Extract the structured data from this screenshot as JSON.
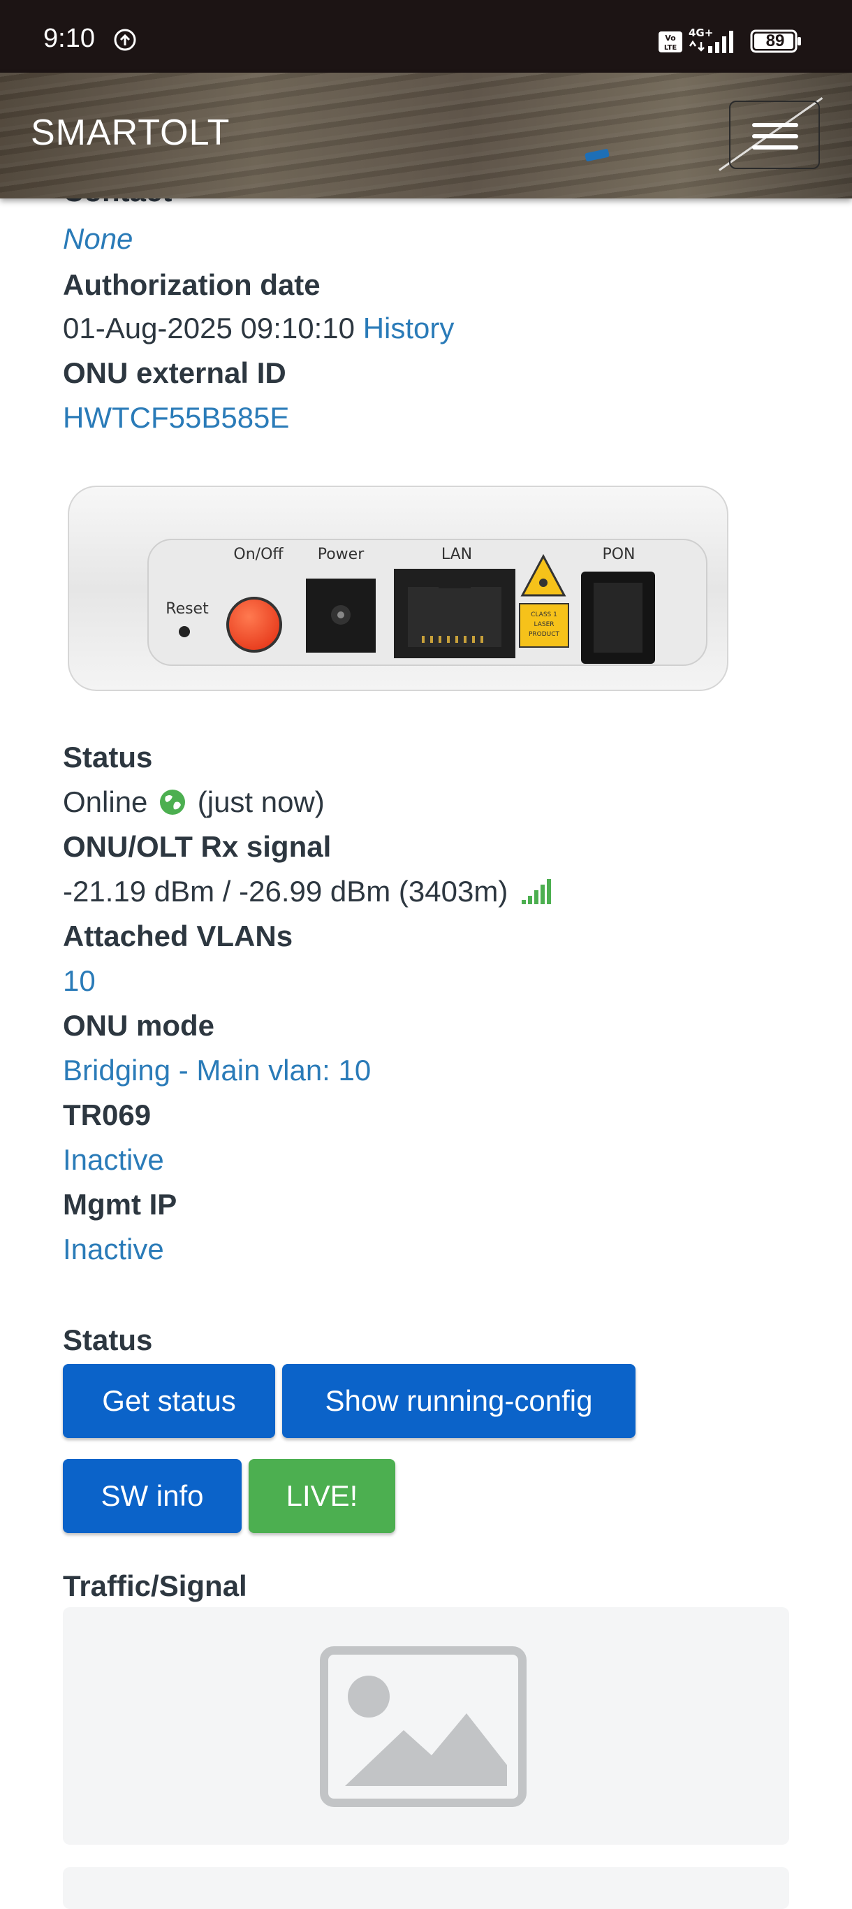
{
  "status_bar": {
    "time": "9:10",
    "net_icon": "data-saver-icon",
    "volte": "Vo LTE",
    "network": "4G+",
    "battery": "89"
  },
  "navbar": {
    "brand": "SMARTOLT",
    "menu_icon": "hamburger-menu-icon"
  },
  "details": {
    "contact_label": "Contact",
    "contact_value": "None",
    "auth_date_label": "Authorization date",
    "auth_date_value": "01-Aug-2025 09:10:10",
    "history_link": "History",
    "external_id_label": "ONU external ID",
    "external_id_value": "HWTCF55B585E",
    "device": {
      "reset": "Reset",
      "on_off": "On/Off",
      "power": "Power",
      "lan": "LAN",
      "pon": "PON",
      "laser_line1": "CLASS 1",
      "laser_line2": "LASER",
      "laser_line3": "PRODUCT"
    },
    "status_label": "Status",
    "status_value": "Online",
    "status_time": "(just now)",
    "rx_signal_label": "ONU/OLT Rx signal",
    "rx_signal_value": "-21.19 dBm / -26.99 dBm (3403m)",
    "vlans_label": "Attached VLANs",
    "vlans_value": "10",
    "onu_mode_label": "ONU mode",
    "onu_mode_value": "Bridging - Main vlan: 10",
    "tr069_label": "TR069",
    "tr069_value": "Inactive",
    "mgmt_ip_label": "Mgmt IP",
    "mgmt_ip_value": "Inactive"
  },
  "status_section": {
    "title": "Status",
    "buttons": {
      "get_status": "Get status",
      "show_running_config": "Show running-config",
      "sw_info": "SW info",
      "live": "LIVE!"
    }
  },
  "traffic_section": {
    "title": "Traffic/Signal",
    "placeholder_icon": "image-placeholder-icon"
  },
  "colors": {
    "link": "#2a7bb8",
    "button_blue": "#0b63c9",
    "button_green": "#4caf50",
    "status_online": "#4caf50"
  }
}
